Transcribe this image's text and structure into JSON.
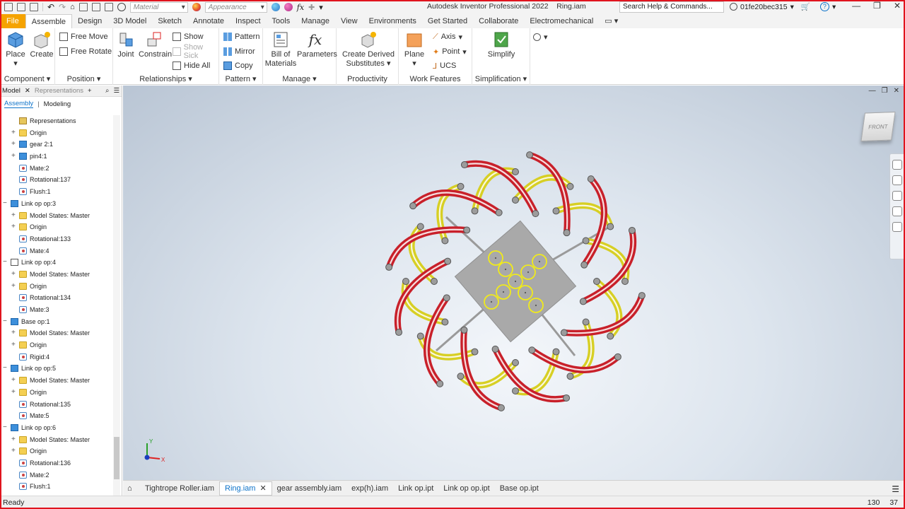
{
  "title_bar": {
    "material_placeholder": "Material",
    "appearance_placeholder": "Appearance",
    "app_title": "Autodesk Inventor Professional 2022",
    "file_name": "Ring.iam",
    "search_text": "Search Help & Commands...",
    "user_name": "01fe20bec315",
    "help_icon": "?"
  },
  "tabs": [
    "File",
    "Assemble",
    "Design",
    "3D Model",
    "Sketch",
    "Annotate",
    "Inspect",
    "Tools",
    "Manage",
    "View",
    "Environments",
    "Get Started",
    "Collaborate",
    "Electromechanical"
  ],
  "ribbon": {
    "component": {
      "title": "Component",
      "place": "Place",
      "create": "Create"
    },
    "position": {
      "title": "Position",
      "free_move": "Free Move",
      "free_rotate": "Free Rotate"
    },
    "relationships": {
      "title": "Relationships",
      "joint": "Joint",
      "constrain": "Constrain",
      "show": "Show",
      "show_sick": "Show Sick",
      "hide_all": "Hide All"
    },
    "pattern": {
      "title": "Pattern",
      "pattern": "Pattern",
      "mirror": "Mirror",
      "copy": "Copy"
    },
    "manage": {
      "title": "Manage",
      "bom_line1": "Bill of",
      "bom_line2": "Materials",
      "parameters": "Parameters"
    },
    "productivity": {
      "title": "Productivity",
      "line1": "Create Derived",
      "line2": "Substitutes"
    },
    "work_features": {
      "title": "Work Features",
      "plane": "Plane",
      "axis": "Axis",
      "point": "Point",
      "ucs": "UCS"
    },
    "simplification": {
      "title": "Simplification",
      "simplify": "Simplify"
    }
  },
  "browser": {
    "tab_model": "Model",
    "tab_representations": "Representations",
    "sub_assembly": "Assembly",
    "sub_modeling": "Modeling",
    "rows": [
      {
        "label": "Representations",
        "icon": "representations-icon",
        "indent": 2,
        "expand": ""
      },
      {
        "label": "Origin",
        "icon": "folder-icon",
        "indent": 2,
        "expand": "+"
      },
      {
        "label": "gear 2:1",
        "icon": "component-icon",
        "indent": 2,
        "expand": "+"
      },
      {
        "label": "pin4:1",
        "icon": "component-icon",
        "indent": 2,
        "expand": "+"
      },
      {
        "label": "Mate:2",
        "icon": "constraint-icon",
        "indent": 2,
        "expand": ""
      },
      {
        "label": "Rotational:137",
        "icon": "constraint-icon",
        "indent": 2,
        "expand": ""
      },
      {
        "label": "Flush:1",
        "icon": "constraint-icon",
        "indent": 2,
        "expand": ""
      },
      {
        "label": "Link op op:3",
        "icon": "component-icon",
        "indent": 1,
        "expand": "−"
      },
      {
        "label": "Model States: Master",
        "icon": "folder-icon",
        "indent": 2,
        "expand": "+"
      },
      {
        "label": "Origin",
        "icon": "folder-icon",
        "indent": 2,
        "expand": "+"
      },
      {
        "label": "Rotational:133",
        "icon": "constraint-icon",
        "indent": 2,
        "expand": ""
      },
      {
        "label": "Mate:4",
        "icon": "constraint-icon",
        "indent": 2,
        "expand": ""
      },
      {
        "label": "Link op op:4",
        "icon": "component-outline-icon",
        "indent": 1,
        "expand": "−"
      },
      {
        "label": "Model States: Master",
        "icon": "folder-icon",
        "indent": 2,
        "expand": "+"
      },
      {
        "label": "Origin",
        "icon": "folder-icon",
        "indent": 2,
        "expand": "+"
      },
      {
        "label": "Rotational:134",
        "icon": "constraint-icon",
        "indent": 2,
        "expand": ""
      },
      {
        "label": "Mate:3",
        "icon": "constraint-icon",
        "indent": 2,
        "expand": ""
      },
      {
        "label": "Base op:1",
        "icon": "component-icon",
        "indent": 1,
        "expand": "−"
      },
      {
        "label": "Model States: Master",
        "icon": "folder-icon",
        "indent": 2,
        "expand": "+"
      },
      {
        "label": "Origin",
        "icon": "folder-icon",
        "indent": 2,
        "expand": "+"
      },
      {
        "label": "Rigid:4",
        "icon": "constraint-icon",
        "indent": 2,
        "expand": ""
      },
      {
        "label": "Link op op:5",
        "icon": "component-icon",
        "indent": 1,
        "expand": "−"
      },
      {
        "label": "Model States: Master",
        "icon": "folder-icon",
        "indent": 2,
        "expand": "+"
      },
      {
        "label": "Origin",
        "icon": "folder-icon",
        "indent": 2,
        "expand": "+"
      },
      {
        "label": "Rotational:135",
        "icon": "constraint-icon",
        "indent": 2,
        "expand": ""
      },
      {
        "label": "Mate:5",
        "icon": "constraint-icon",
        "indent": 2,
        "expand": ""
      },
      {
        "label": "Link op op:6",
        "icon": "component-icon",
        "indent": 1,
        "expand": "−"
      },
      {
        "label": "Model States: Master",
        "icon": "folder-icon",
        "indent": 2,
        "expand": "+"
      },
      {
        "label": "Origin",
        "icon": "folder-icon",
        "indent": 2,
        "expand": "+"
      },
      {
        "label": "Rotational:136",
        "icon": "constraint-icon",
        "indent": 2,
        "expand": ""
      },
      {
        "label": "Mate:2",
        "icon": "constraint-icon",
        "indent": 2,
        "expand": ""
      },
      {
        "label": "Flush:1",
        "icon": "constraint-icon",
        "indent": 2,
        "expand": ""
      }
    ]
  },
  "viewport": {
    "viewcube_label": "FRONT",
    "model_colors": {
      "link_red": "#c8202a",
      "link_yellow": "#d7cf24",
      "base_gray": "#a9a9a9",
      "pin_gray": "#8a8a8a"
    },
    "axis_x_label": "X",
    "axis_y_label": "Y"
  },
  "doc_tabs": [
    "Tightrope Roller.iam",
    "Ring.iam",
    "gear assembly.iam",
    "exp(h).iam",
    "Link op.ipt",
    "Link op op.ipt",
    "Base op.ipt"
  ],
  "status": {
    "text": "Ready",
    "value1": "130",
    "value2": "37"
  }
}
